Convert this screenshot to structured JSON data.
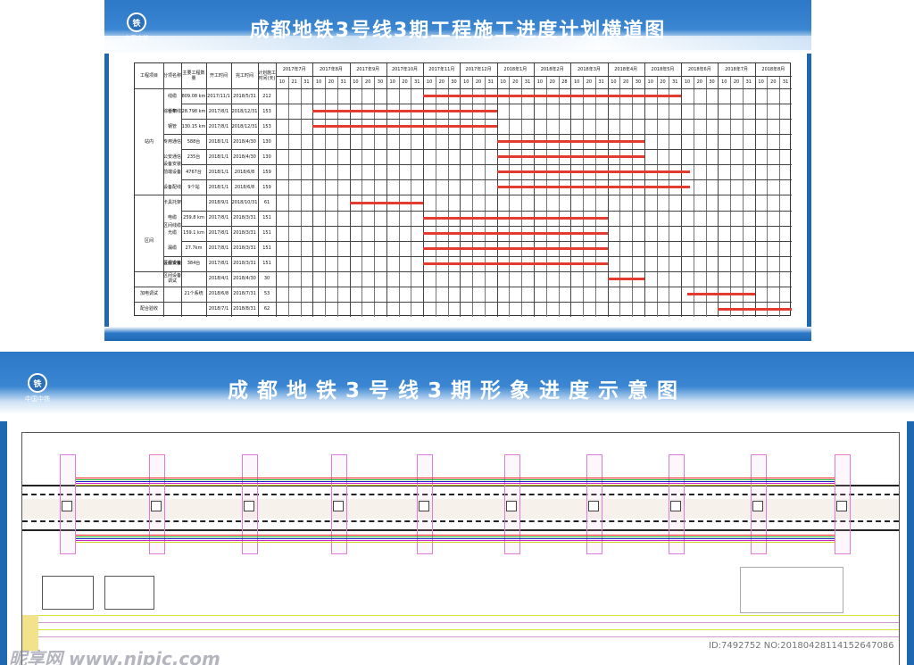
{
  "board1": {
    "title": "成都地铁3号线3期工程施工进度计划横道图",
    "logo_text": "中国中铁",
    "bar_color": "#e23c30",
    "headers": [
      "工程项目",
      "分项名称",
      "主要工程数量",
      "开工时间",
      "完工时间",
      "计划施工时间(天)"
    ],
    "months": [
      "2017年7月",
      "2017年8月",
      "2017年9月",
      "2017年10月",
      "2017年11月",
      "2017年12月",
      "2018年1月",
      "2018年2月",
      "2018年3月",
      "2018年4月",
      "2018年5月",
      "2018年6月",
      "2018年7月",
      "2018年8月"
    ],
    "day_ticks": [
      "10",
      "21",
      "31",
      "10",
      "20",
      "31",
      "10",
      "20",
      "30",
      "10",
      "20",
      "31",
      "10",
      "20",
      "30",
      "10",
      "20",
      "31",
      "10",
      "20",
      "31",
      "10",
      "20",
      "28",
      "10",
      "20",
      "31",
      "10",
      "20",
      "30",
      "10",
      "20",
      "31",
      "10",
      "20",
      "30",
      "10",
      "20",
      "31",
      "10",
      "20",
      "31"
    ],
    "groups": [
      {
        "name": "站内",
        "subgroups": [
          {
            "name": "综合布线",
            "rows": [
              0,
              1,
              2
            ]
          },
          {
            "name": "设备安装",
            "rows": [
              3,
              4,
              5,
              6
            ]
          }
        ]
      },
      {
        "name": "区间",
        "subgroups": [
          {
            "name": "区间线缆",
            "rows": [
              7,
              8,
              9,
              10
            ]
          },
          {
            "name": "设备安装",
            "rows": [
              11
            ]
          }
        ]
      }
    ],
    "rows": [
      {
        "item": "线缆",
        "qty": "809.08 km",
        "start": "2017/11/1",
        "end": "2018/5/31",
        "days": "212",
        "bar": [
          12,
          33
        ]
      },
      {
        "item": "桥架",
        "qty": "28.798 km",
        "start": "2017/8/1",
        "end": "2018/12/31",
        "days": "153",
        "bar": [
          3,
          18
        ]
      },
      {
        "item": "钢管",
        "qty": "130.15 km",
        "start": "2017/8/1",
        "end": "2018/12/31",
        "days": "153",
        "bar": [
          3,
          18
        ]
      },
      {
        "item": "专用通信",
        "qty": "588台",
        "start": "2018/1/1",
        "end": "2018/4/30",
        "days": "130",
        "bar": [
          18,
          30
        ]
      },
      {
        "item": "公安通信",
        "qty": "235台",
        "start": "2018/1/1",
        "end": "2018/4/30",
        "days": "130",
        "bar": [
          18,
          30
        ]
      },
      {
        "item": "前端设备",
        "qty": "4767台",
        "start": "2018/1/1",
        "end": "2018/6/8",
        "days": "159",
        "bar": [
          18,
          33.7
        ]
      },
      {
        "item": "设备配线",
        "qty": "9个站",
        "start": "2018/1/1",
        "end": "2018/6/8",
        "days": "159",
        "bar": [
          18,
          33.7
        ]
      },
      {
        "item": "卡具托架",
        "qty": "",
        "start": "2018/9/1",
        "end": "2018/10/31",
        "days": "61",
        "bar": [
          6,
          12
        ]
      },
      {
        "item": "电缆",
        "qty": "259.8 km",
        "start": "2017/8/1",
        "end": "2018/3/31",
        "days": "151",
        "bar": [
          12,
          27
        ]
      },
      {
        "item": "光缆",
        "qty": "159.1 km",
        "start": "2017/8/1",
        "end": "2018/3/31",
        "days": "151",
        "bar": [
          12,
          27
        ]
      },
      {
        "item": "漏缆",
        "qty": "27.7km",
        "start": "2017/8/1",
        "end": "2018/3/31",
        "days": "151",
        "bar": [
          12,
          27
        ]
      },
      {
        "item": "区间设备",
        "qty": "384台",
        "start": "2017/8/1",
        "end": "2018/3/31",
        "days": "151",
        "bar": [
          12,
          27
        ]
      },
      {
        "item": "区间设备调试",
        "qty": "",
        "start": "2018/4/1",
        "end": "2018/4/30",
        "days": "30",
        "bar": [
          27,
          30
        ]
      },
      {
        "item": "",
        "qty": "21个系统",
        "start": "2018/6/8",
        "end": "2018/7/31",
        "days": "53",
        "bar": [
          33.5,
          39
        ]
      },
      {
        "item": "",
        "qty": "",
        "start": "2018/7/1",
        "end": "2018/8/31",
        "days": "62",
        "bar": [
          36,
          42
        ]
      }
    ],
    "extra_labels": [
      {
        "label": "加电调试",
        "row": 13
      },
      {
        "label": "配合验收",
        "row": 14
      }
    ]
  },
  "board2": {
    "title": "成都地铁3号线3期形象进度示意图",
    "logo_text": "中国中铁"
  },
  "watermark": {
    "site": "昵享网 www.nipic.com",
    "id": "ID:7492752 NO:20180428114152647086"
  }
}
